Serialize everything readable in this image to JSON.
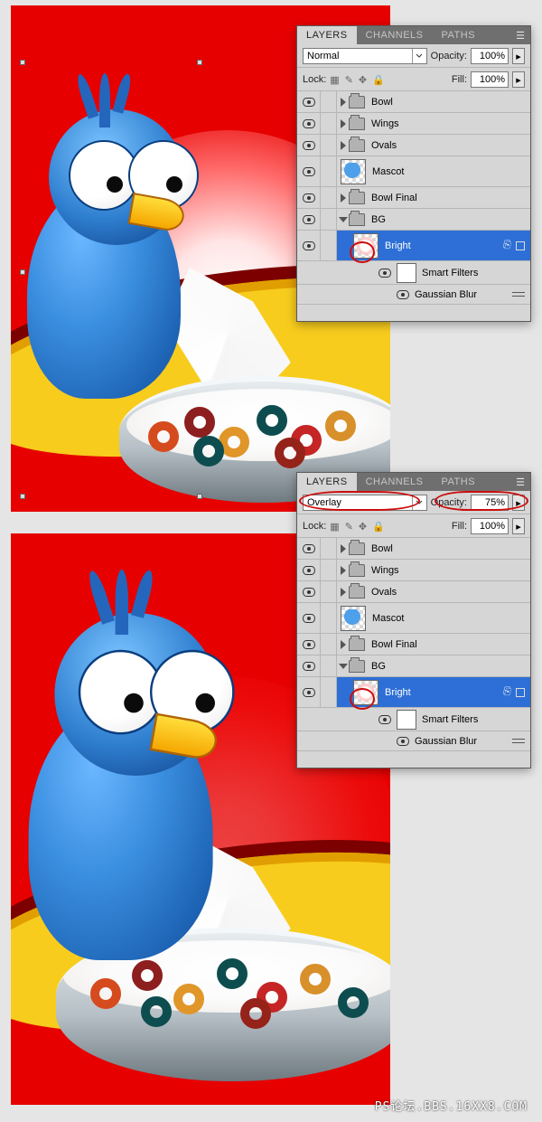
{
  "watermark": "PS论坛.BBS.16XX8.COM",
  "panel1": {
    "tabs": [
      "LAYERS",
      "CHANNELS",
      "PATHS"
    ],
    "blend_mode": "Normal",
    "opacity_label": "Opacity:",
    "opacity_value": "100%",
    "lock_label": "Lock:",
    "fill_label": "Fill:",
    "fill_value": "100%",
    "layers": {
      "bowl": "Bowl",
      "wings": "Wings",
      "ovals": "Ovals",
      "mascot": "Mascot",
      "bowl_final": "Bowl Final",
      "bg": "BG",
      "bright": "Bright",
      "smart_filters": "Smart Filters",
      "gaussian": "Gaussian Blur"
    }
  },
  "panel2": {
    "tabs": [
      "LAYERS",
      "CHANNELS",
      "PATHS"
    ],
    "blend_mode": "Overlay",
    "opacity_label": "Opacity:",
    "opacity_value": "75%",
    "lock_label": "Lock:",
    "fill_label": "Fill:",
    "fill_value": "100%",
    "layers": {
      "bowl": "Bowl",
      "wings": "Wings",
      "ovals": "Ovals",
      "mascot": "Mascot",
      "bowl_final": "Bowl Final",
      "bg": "BG",
      "bright": "Bright",
      "smart_filters": "Smart Filters",
      "gaussian": "Gaussian Blur"
    }
  }
}
